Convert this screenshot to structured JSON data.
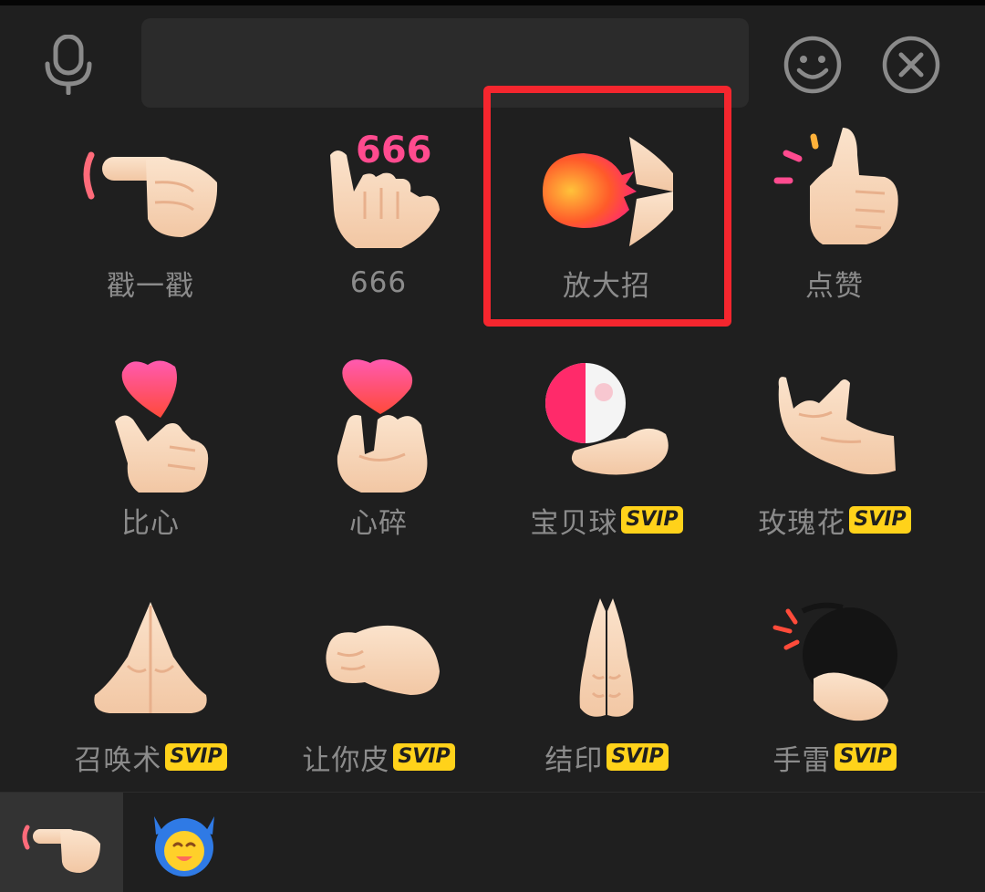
{
  "input": {
    "placeholder": ""
  },
  "stickers": [
    {
      "label": "戳一戳",
      "badge": null,
      "icon": "poke-hand-icon"
    },
    {
      "label": "666",
      "badge": null,
      "icon": "six-six-six-hand-icon"
    },
    {
      "label": "放大招",
      "badge": null,
      "icon": "fireball-hands-icon"
    },
    {
      "label": "点赞",
      "badge": null,
      "icon": "thumbs-up-icon"
    },
    {
      "label": "比心",
      "badge": null,
      "icon": "finger-heart-icon"
    },
    {
      "label": "心碎",
      "badge": null,
      "icon": "broken-heart-hands-icon"
    },
    {
      "label": "宝贝球",
      "badge": "SVIP",
      "icon": "pokeball-hand-icon"
    },
    {
      "label": "玫瑰花",
      "badge": "SVIP",
      "icon": "rose-hand-icon"
    },
    {
      "label": "召唤术",
      "badge": "SVIP",
      "icon": "summon-hands-icon"
    },
    {
      "label": "让你皮",
      "badge": "SVIP",
      "icon": "pinch-hand-icon"
    },
    {
      "label": "结印",
      "badge": "SVIP",
      "icon": "seal-hands-icon"
    },
    {
      "label": "手雷",
      "badge": "SVIP",
      "icon": "grenade-hand-icon"
    }
  ],
  "bottom_tabs": [
    {
      "icon": "poke-hand-icon",
      "selected": true
    },
    {
      "icon": "devil-face-icon",
      "selected": false
    }
  ],
  "colors": {
    "background": "#1f1f1f",
    "highlight": "#f5262e",
    "badge": "#ffd21a",
    "label": "#8b8b8b"
  }
}
